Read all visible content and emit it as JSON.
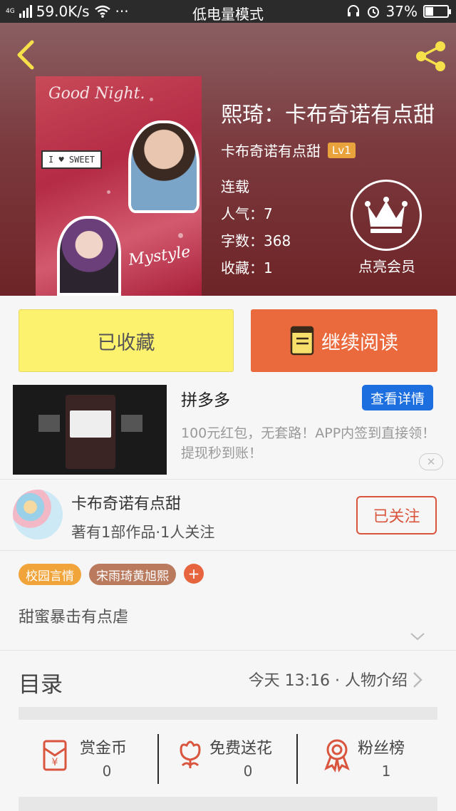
{
  "status_bar": {
    "network_type": "4G",
    "speed": "59.0K/s",
    "more": "···",
    "mode": "低电量模式",
    "battery": "37%",
    "battery_level": 0.37
  },
  "book": {
    "title": "熙琦：卡布奇诺有点甜",
    "author": "卡布奇诺有点甜",
    "author_level": "Lv1",
    "status": "连载",
    "popularity": "人气：7",
    "word_count": "字数：368",
    "favorites": "收藏：1",
    "cover_text_1": "Good Night.",
    "cover_text_2": "I ♥ SWEET",
    "cover_text_3": "Mystyle"
  },
  "vip": {
    "label": "点亮会员"
  },
  "actions": {
    "collected": "已收藏",
    "continue_reading": "继续阅读"
  },
  "ad": {
    "title": "拼多多",
    "detail_button": "查看详情",
    "description": "100元红包，无套路！APP内签到直接领！提现秒到账！"
  },
  "author_card": {
    "name": "卡布奇诺有点甜",
    "stats": "著有1部作品·1人关注",
    "follow_button": "已关注"
  },
  "tags": [
    {
      "label": "校园言情",
      "color": "#f0a43a"
    },
    {
      "label": "宋雨琦黄旭熙",
      "color": "#b97a5e"
    }
  ],
  "summary": "甜蜜暴击有点虐",
  "toc": {
    "label": "目录",
    "latest": "今天 13:16 · 人物介绍"
  },
  "stats": {
    "reward": {
      "label": "赏金币",
      "value": "0"
    },
    "flowers": {
      "label": "免费送花",
      "value": "0"
    },
    "fans": {
      "label": "粉丝榜",
      "value": "1"
    }
  },
  "colors": {
    "accent_red": "#d9553e",
    "collect_yellow": "#fdf26e",
    "read_orange": "#ea6a3e",
    "level_badge": "#e8a33c",
    "ad_button_blue": "#1d6fe0"
  }
}
